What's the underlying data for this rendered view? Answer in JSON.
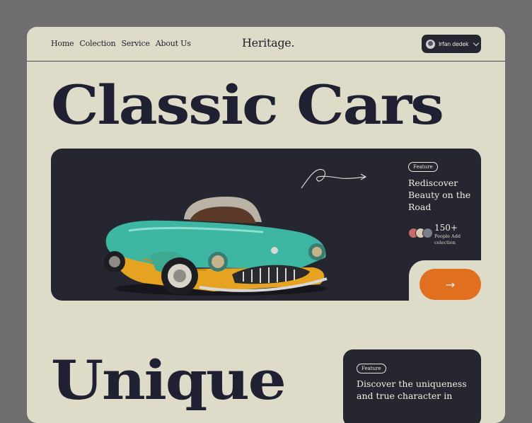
{
  "nav": {
    "items": [
      "Home",
      "Colection",
      "Service",
      "About Us"
    ]
  },
  "brand": "Heritage.",
  "user": {
    "name": "Irfan dedek",
    "icons": [
      "avatar",
      "chevron-down-icon"
    ]
  },
  "hero": {
    "headline": "Classic Cars",
    "badge": "Feature",
    "title": "Rediscover Beauty on the Road",
    "count": "150+",
    "count_caption": "People Add colection",
    "cta_icon": "arrow-right-icon",
    "colors": {
      "panel": "#262630",
      "accent": "#e07020",
      "page": "#dedbc8"
    }
  },
  "section2": {
    "headline": "Unique",
    "badge": "Feature",
    "text": "Discover the uniqueness and true character in"
  }
}
